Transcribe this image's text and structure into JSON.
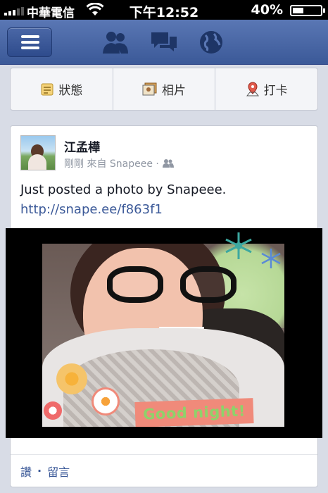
{
  "status_bar": {
    "carrier": "中華電信",
    "time": "下午12:52",
    "battery_percent_text": "40%",
    "battery_level": 0.4,
    "icons": [
      "signal-bars-icon",
      "wifi-icon",
      "battery-icon"
    ]
  },
  "navbar": {
    "menu_icon": "hamburger-icon",
    "icons": [
      "friend-requests-icon",
      "messages-icon",
      "notifications-globe-icon"
    ],
    "color": "#3b5998"
  },
  "composer": {
    "status_label": "狀態",
    "photo_label": "相片",
    "checkin_label": "打卡"
  },
  "post": {
    "author": "江孟樺",
    "meta": "剛剛 來自 Snapeee ·",
    "privacy_icon": "friends-audience-icon",
    "text": "Just posted a photo by Snapeee.",
    "link": "http://snape.ee/f863f1",
    "photo_caption": "Good night!",
    "actions": {
      "like": "讚",
      "separator": "·",
      "comment": "留言"
    }
  },
  "colors": {
    "accent": "#3b5998",
    "background": "#d8dce6",
    "card": "#ffffff"
  }
}
